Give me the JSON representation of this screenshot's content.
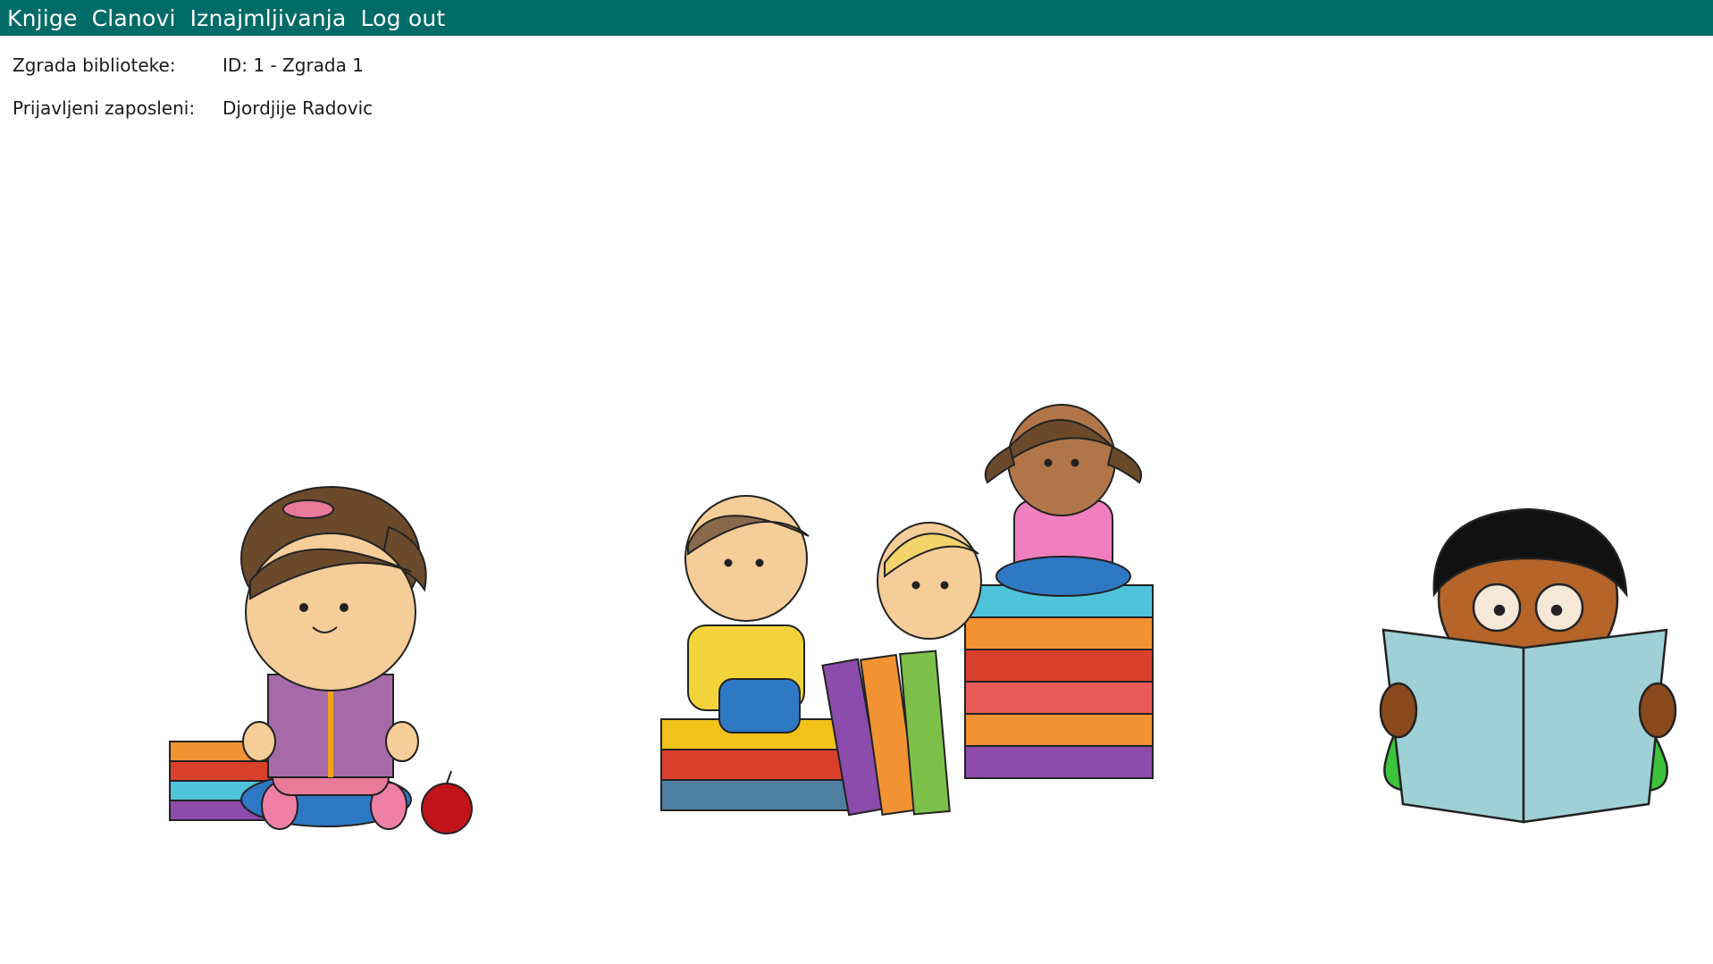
{
  "menu": {
    "items": [
      {
        "label": "Knjige"
      },
      {
        "label": "Clanovi"
      },
      {
        "label": "Iznajmljivanja"
      },
      {
        "label": "Log out"
      }
    ]
  },
  "info": {
    "building_label": "Zgrada biblioteke:",
    "building_value": "ID: 1 - Zgrada 1",
    "employee_label": "Prijavljeni zaposleni:",
    "employee_value": "Djordjije Radovic"
  },
  "colors": {
    "menubar": "#006b67",
    "menu_text": "#ffffff"
  }
}
